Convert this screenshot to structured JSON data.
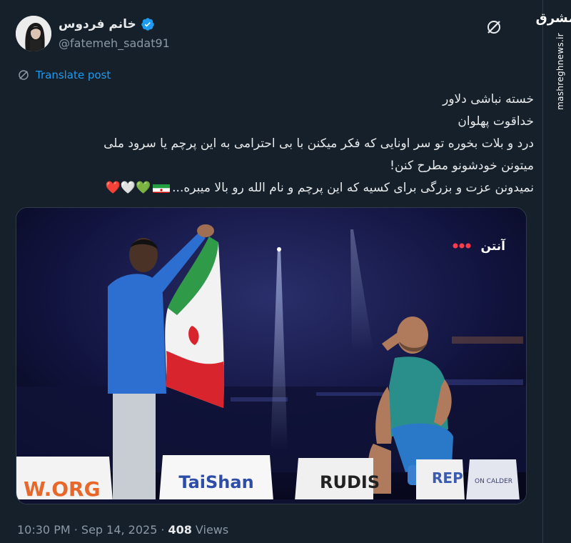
{
  "author": {
    "display_name": "خانم فردوس",
    "handle": "@fatemeh_sadat91",
    "verified": true
  },
  "translate_label": "Translate post",
  "tweet_lines": [
    "خسته نباشی دلاور",
    "خداقوت پهلوان",
    "درد و بلات بخوره تو سر اونایی که فکر میکنن با بی احترامی به این پرچم یا سرود ملی",
    "میتونن خودشونو مطرح کنن!",
    "نمیدونن عزت و بزرگی برای کسیه که این پرچم و نام الله رو بالا میبره..."
  ],
  "emoji_hearts": [
    "💚",
    "🤍",
    "❤️"
  ],
  "media": {
    "broadcaster_logo": "آنتن",
    "boards": [
      "W.ORG",
      "TaiShan",
      "RUDIS",
      "REP",
      "ON CALDER"
    ]
  },
  "timestamp": "10:30 PM · Sep 14, 2025",
  "views_count": "408",
  "views_label": "Views",
  "watermark": {
    "logo": "مشرق",
    "site": "mashreghnews.ir"
  },
  "icons": [
    "verified-icon",
    "grok-icon",
    "translate-icon"
  ],
  "colors": {
    "background": "#15202b",
    "link": "#1d9bf0",
    "muted": "#8b98a5",
    "text": "#e7e9ea"
  }
}
